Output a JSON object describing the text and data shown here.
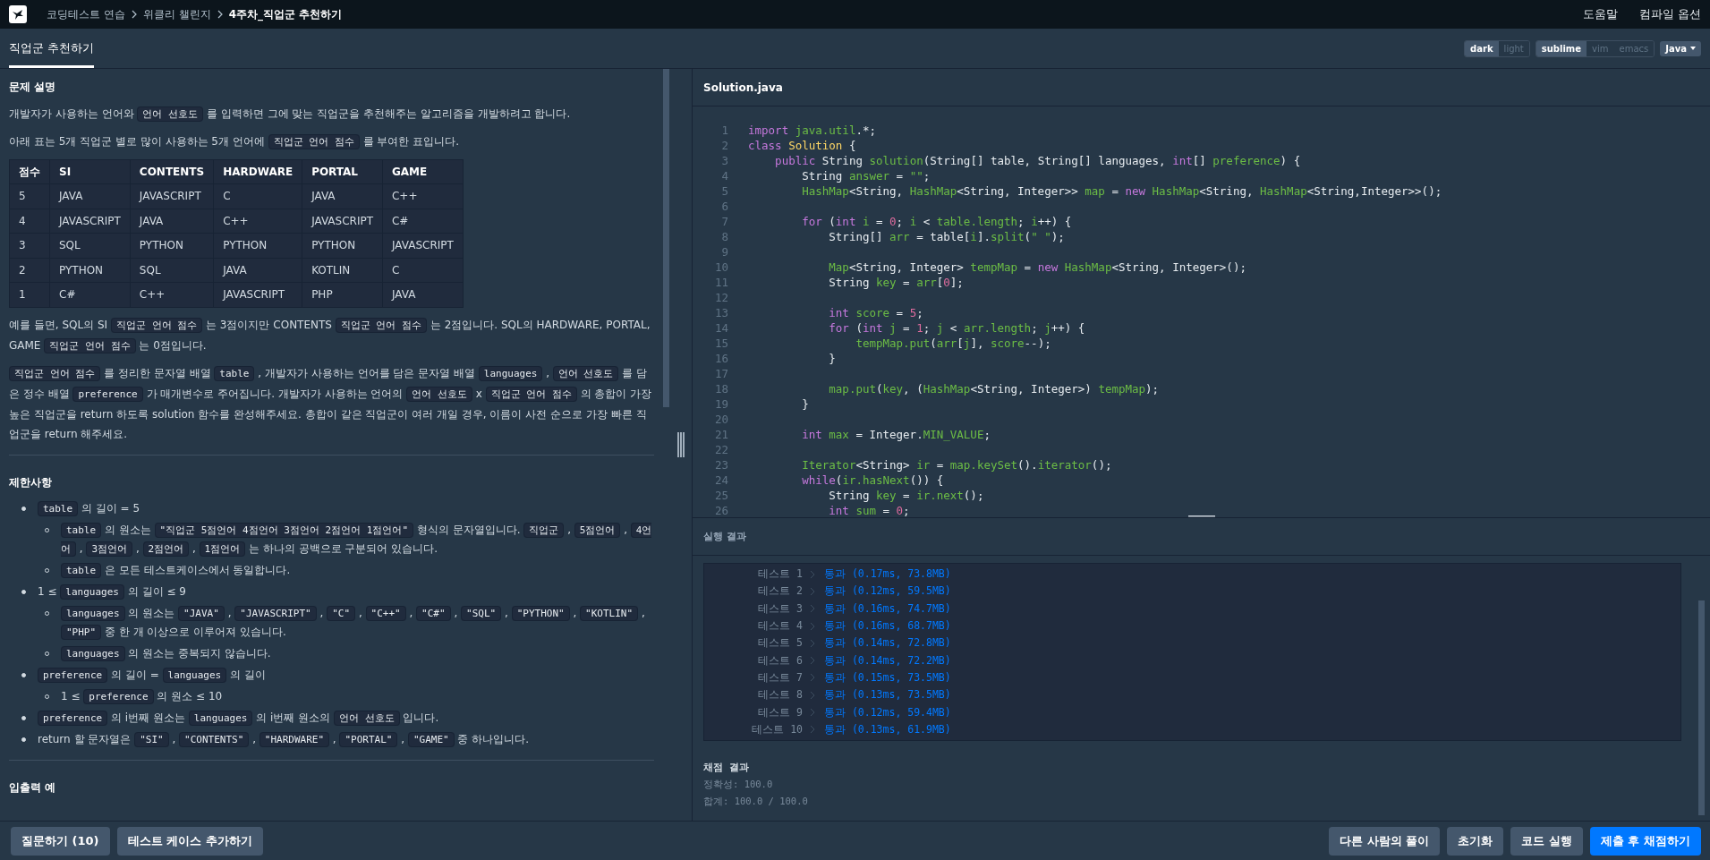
{
  "nav": {
    "breadcrumbs": [
      {
        "text": "코딩테스트 연습",
        "current": false
      },
      {
        "text": "위클리 챌린지",
        "current": false
      },
      {
        "text": "4주차_직업군 추천하기",
        "current": true
      }
    ],
    "links": [
      "도움말",
      "컴파일 옵션"
    ]
  },
  "tab": {
    "label": "직업군 추천하기",
    "selected": true
  },
  "editor_options": [
    [
      {
        "label": "dark",
        "selected": true
      },
      {
        "label": "light",
        "selected": false
      }
    ],
    [
      {
        "label": "sublime",
        "selected": true
      },
      {
        "label": "vim",
        "selected": false
      },
      {
        "label": "emacs",
        "selected": false
      }
    ]
  ],
  "language_select": {
    "value": "Java"
  },
  "problem": {
    "sections": [
      {
        "title": "문제 설명",
        "blocks": [
          {
            "kind": "paragraph",
            "segments": [
              {
                "kind": "text",
                "text": "개발자가 사용하는 언어와 "
              },
              {
                "kind": "code",
                "text": "언어 선호도"
              },
              {
                "kind": "text",
                "text": " 를 입력하면 그에 맞는 직업군을 추천해주는 알고리즘을 개발하려고 합니다."
              }
            ]
          },
          {
            "kind": "paragraph",
            "segments": [
              {
                "kind": "text",
                "text": "아래 표는 5개 직업군 별로 많이 사용하는 5개 언어에 "
              },
              {
                "kind": "code",
                "text": "직업군 언어 점수"
              },
              {
                "kind": "text",
                "text": " 를 부여한 표입니다."
              }
            ]
          },
          {
            "kind": "table",
            "columns": [
              "점수",
              "SI",
              "CONTENTS",
              "HARDWARE",
              "PORTAL",
              "GAME"
            ],
            "rows": [
              [
                "5",
                "JAVA",
                "JAVASCRIPT",
                "C",
                "JAVA",
                "C++"
              ],
              [
                "4",
                "JAVASCRIPT",
                "JAVA",
                "C++",
                "JAVASCRIPT",
                "C#"
              ],
              [
                "3",
                "SQL",
                "PYTHON",
                "PYTHON",
                "PYTHON",
                "JAVASCRIPT"
              ],
              [
                "2",
                "PYTHON",
                "SQL",
                "JAVA",
                "KOTLIN",
                "C"
              ],
              [
                "1",
                "C#",
                "C++",
                "JAVASCRIPT",
                "PHP",
                "JAVA"
              ]
            ]
          },
          {
            "kind": "paragraph",
            "segments": [
              {
                "kind": "text",
                "text": "예를 들면, SQL의 SI "
              },
              {
                "kind": "code",
                "text": "직업군 언어 점수"
              },
              {
                "kind": "text",
                "text": " 는 3점이지만 CONTENTS "
              },
              {
                "kind": "code",
                "text": "직업군 언어 점수"
              },
              {
                "kind": "text",
                "text": " 는 2점입니다. SQL의 HARDWARE, PORTAL, GAME "
              },
              {
                "kind": "code",
                "text": "직업군 언어 점수"
              },
              {
                "kind": "text",
                "text": " 는 0점입니다."
              }
            ]
          },
          {
            "kind": "paragraph",
            "segments": [
              {
                "kind": "code",
                "text": "직업군 언어 점수"
              },
              {
                "kind": "text",
                "text": " 를 정리한 문자열 배열 "
              },
              {
                "kind": "code",
                "text": "table"
              },
              {
                "kind": "text",
                "text": " , 개발자가 사용하는 언어를 담은 문자열 배열 "
              },
              {
                "kind": "code",
                "text": "languages"
              },
              {
                "kind": "text",
                "text": " , "
              },
              {
                "kind": "code",
                "text": "언어 선호도"
              },
              {
                "kind": "text",
                "text": " 를 담은 정수 배열 "
              },
              {
                "kind": "code",
                "text": "preference"
              },
              {
                "kind": "text",
                "text": " 가 매개변수로 주어집니다. 개발자가 사용하는 언어의 "
              },
              {
                "kind": "code",
                "text": "언어 선호도"
              },
              {
                "kind": "text",
                "text": " x "
              },
              {
                "kind": "code",
                "text": "직업군 언어 점수"
              },
              {
                "kind": "text",
                "text": " 의 총합이 가장 높은 직업군을 return 하도록 solution 함수를 완성해주세요. 총합이 같은 직업군이 여러 개일 경우, 이름이 사전 순으로 가장 빠른 직업군을 return 해주세요."
              }
            ]
          }
        ]
      },
      {
        "title": "제한사항",
        "blocks": [
          {
            "kind": "list",
            "items": [
              {
                "segments": [
                  {
                    "kind": "code",
                    "text": "table"
                  },
                  {
                    "kind": "text",
                    "text": " 의 길이 = 5"
                  }
                ],
                "children": [
                  {
                    "segments": [
                      {
                        "kind": "code",
                        "text": "table"
                      },
                      {
                        "kind": "text",
                        "text": " 의 원소는 "
                      },
                      {
                        "kind": "code",
                        "text": "\"직업군 5점언어 4점언어 3점언어 2점언어 1점언어\""
                      },
                      {
                        "kind": "text",
                        "text": " 형식의 문자열입니다. "
                      },
                      {
                        "kind": "code",
                        "text": "직업군"
                      },
                      {
                        "kind": "text",
                        "text": " , "
                      },
                      {
                        "kind": "code",
                        "text": "5점언어"
                      },
                      {
                        "kind": "text",
                        "text": " , "
                      },
                      {
                        "kind": "code",
                        "text": "4언어"
                      },
                      {
                        "kind": "text",
                        "text": " , "
                      },
                      {
                        "kind": "code",
                        "text": "3점언어"
                      },
                      {
                        "kind": "text",
                        "text": " , "
                      },
                      {
                        "kind": "code",
                        "text": "2점언어"
                      },
                      {
                        "kind": "text",
                        "text": " , "
                      },
                      {
                        "kind": "code",
                        "text": "1점언어"
                      },
                      {
                        "kind": "text",
                        "text": " 는 하나의 공백으로 구분되어 있습니다."
                      }
                    ]
                  },
                  {
                    "segments": [
                      {
                        "kind": "code",
                        "text": "table"
                      },
                      {
                        "kind": "text",
                        "text": " 은 모든 테스트케이스에서 동일합니다."
                      }
                    ]
                  }
                ]
              },
              {
                "segments": [
                  {
                    "kind": "text",
                    "text": "1 ≤ "
                  },
                  {
                    "kind": "code",
                    "text": "languages"
                  },
                  {
                    "kind": "text",
                    "text": " 의 길이 ≤ 9"
                  }
                ],
                "children": [
                  {
                    "segments": [
                      {
                        "kind": "code",
                        "text": "languages"
                      },
                      {
                        "kind": "text",
                        "text": " 의 원소는 "
                      },
                      {
                        "kind": "code",
                        "text": "\"JAVA\""
                      },
                      {
                        "kind": "text",
                        "text": " , "
                      },
                      {
                        "kind": "code",
                        "text": "\"JAVASCRIPT\""
                      },
                      {
                        "kind": "text",
                        "text": " , "
                      },
                      {
                        "kind": "code",
                        "text": "\"C\""
                      },
                      {
                        "kind": "text",
                        "text": " , "
                      },
                      {
                        "kind": "code",
                        "text": "\"C++\""
                      },
                      {
                        "kind": "text",
                        "text": " , "
                      },
                      {
                        "kind": "code",
                        "text": "\"C#\""
                      },
                      {
                        "kind": "text",
                        "text": " , "
                      },
                      {
                        "kind": "code",
                        "text": "\"SQL\""
                      },
                      {
                        "kind": "text",
                        "text": " , "
                      },
                      {
                        "kind": "code",
                        "text": "\"PYTHON\""
                      },
                      {
                        "kind": "text",
                        "text": " , "
                      },
                      {
                        "kind": "code",
                        "text": "\"KOTLIN\""
                      },
                      {
                        "kind": "text",
                        "text": " , "
                      },
                      {
                        "kind": "code",
                        "text": "\"PHP\""
                      },
                      {
                        "kind": "text",
                        "text": " 중 한 개 이상으로 이루어져 있습니다."
                      }
                    ]
                  },
                  {
                    "segments": [
                      {
                        "kind": "code",
                        "text": "languages"
                      },
                      {
                        "kind": "text",
                        "text": " 의 원소는 중복되지 않습니다."
                      }
                    ]
                  }
                ]
              },
              {
                "segments": [
                  {
                    "kind": "code",
                    "text": "preference"
                  },
                  {
                    "kind": "text",
                    "text": " 의 길이 = "
                  },
                  {
                    "kind": "code",
                    "text": "languages"
                  },
                  {
                    "kind": "text",
                    "text": " 의 길이"
                  }
                ],
                "children": [
                  {
                    "segments": [
                      {
                        "kind": "text",
                        "text": "1 ≤ "
                      },
                      {
                        "kind": "code",
                        "text": "preference"
                      },
                      {
                        "kind": "text",
                        "text": " 의 원소 ≤ 10"
                      }
                    ]
                  }
                ]
              },
              {
                "segments": [
                  {
                    "kind": "code",
                    "text": "preference"
                  },
                  {
                    "kind": "text",
                    "text": " 의 i번째 원소는 "
                  },
                  {
                    "kind": "code",
                    "text": "languages"
                  },
                  {
                    "kind": "text",
                    "text": " 의 i번째 원소의 "
                  },
                  {
                    "kind": "code",
                    "text": "언어 선호도"
                  },
                  {
                    "kind": "text",
                    "text": " 입니다."
                  }
                ]
              },
              {
                "segments": [
                  {
                    "kind": "text",
                    "text": "return 할 문자열은 "
                  },
                  {
                    "kind": "code",
                    "text": "\"SI\""
                  },
                  {
                    "kind": "text",
                    "text": " , "
                  },
                  {
                    "kind": "code",
                    "text": "\"CONTENTS\""
                  },
                  {
                    "kind": "text",
                    "text": " , "
                  },
                  {
                    "kind": "code",
                    "text": "\"HARDWARE\""
                  },
                  {
                    "kind": "text",
                    "text": " , "
                  },
                  {
                    "kind": "code",
                    "text": "\"PORTAL\""
                  },
                  {
                    "kind": "text",
                    "text": " , "
                  },
                  {
                    "kind": "code",
                    "text": "\"GAME\""
                  },
                  {
                    "kind": "text",
                    "text": " 중 하나입니다."
                  }
                ]
              }
            ]
          }
        ]
      },
      {
        "title": "입출력 예"
      }
    ]
  },
  "editor": {
    "filename": "Solution.java",
    "lines": [
      {
        "number": "1",
        "tokens": [
          {
            "kind": "k",
            "text": "import "
          },
          {
            "kind": "v",
            "text": "java.util"
          },
          {
            "kind": "p",
            "text": ".*;"
          }
        ]
      },
      {
        "number": "2",
        "tokens": [
          {
            "kind": "k",
            "text": "class "
          },
          {
            "kind": "c",
            "text": "Solution"
          },
          {
            "kind": "p",
            "text": " {"
          }
        ]
      },
      {
        "number": "3",
        "tokens": [
          {
            "kind": "k",
            "text": "    public "
          },
          {
            "kind": "p",
            "text": "String "
          },
          {
            "kind": "v",
            "text": "solution"
          },
          {
            "kind": "p",
            "text": "(String[] table, String[] languages, "
          },
          {
            "kind": "k",
            "text": "int"
          },
          {
            "kind": "p",
            "text": "[] "
          },
          {
            "kind": "v",
            "text": "preference"
          },
          {
            "kind": "p",
            "text": ") {"
          }
        ]
      },
      {
        "number": "4",
        "tokens": [
          {
            "kind": "p",
            "text": "        String "
          },
          {
            "kind": "v",
            "text": "answer"
          },
          {
            "kind": "p",
            "text": " = "
          },
          {
            "kind": "s",
            "text": "\"\""
          },
          {
            "kind": "p",
            "text": ";"
          }
        ]
      },
      {
        "number": "5",
        "tokens": [
          {
            "kind": "v",
            "text": "        HashMap"
          },
          {
            "kind": "p",
            "text": "<String, "
          },
          {
            "kind": "v",
            "text": "HashMap"
          },
          {
            "kind": "p",
            "text": "<String, Integer>> "
          },
          {
            "kind": "v",
            "text": "map"
          },
          {
            "kind": "p",
            "text": " = "
          },
          {
            "kind": "k",
            "text": "new "
          },
          {
            "kind": "v",
            "text": "HashMap"
          },
          {
            "kind": "p",
            "text": "<String, "
          },
          {
            "kind": "v",
            "text": "HashMap"
          },
          {
            "kind": "p",
            "text": "<String,Integer>>();"
          }
        ]
      },
      {
        "number": "6"
      },
      {
        "number": "7",
        "tokens": [
          {
            "kind": "k",
            "text": "        for "
          },
          {
            "kind": "p",
            "text": "("
          },
          {
            "kind": "k",
            "text": "int "
          },
          {
            "kind": "v",
            "text": "i"
          },
          {
            "kind": "p",
            "text": " = "
          },
          {
            "kind": "n",
            "text": "0"
          },
          {
            "kind": "p",
            "text": "; "
          },
          {
            "kind": "v",
            "text": "i"
          },
          {
            "kind": "p",
            "text": " < "
          },
          {
            "kind": "v",
            "text": "table.length"
          },
          {
            "kind": "p",
            "text": "; "
          },
          {
            "kind": "v",
            "text": "i"
          },
          {
            "kind": "p",
            "text": "++) {"
          }
        ]
      },
      {
        "number": "8",
        "tokens": [
          {
            "kind": "p",
            "text": "            String[] "
          },
          {
            "kind": "v",
            "text": "arr"
          },
          {
            "kind": "p",
            "text": " = table["
          },
          {
            "kind": "v",
            "text": "i"
          },
          {
            "kind": "p",
            "text": "]."
          },
          {
            "kind": "v",
            "text": "split"
          },
          {
            "kind": "p",
            "text": "("
          },
          {
            "kind": "s",
            "text": "\" \""
          },
          {
            "kind": "p",
            "text": ");"
          }
        ]
      },
      {
        "number": "9"
      },
      {
        "number": "10",
        "tokens": [
          {
            "kind": "v",
            "text": "            Map"
          },
          {
            "kind": "p",
            "text": "<String, Integer> "
          },
          {
            "kind": "v",
            "text": "tempMap"
          },
          {
            "kind": "p",
            "text": " = "
          },
          {
            "kind": "k",
            "text": "new "
          },
          {
            "kind": "v",
            "text": "HashMap"
          },
          {
            "kind": "p",
            "text": "<String, Integer>();"
          }
        ]
      },
      {
        "number": "11",
        "tokens": [
          {
            "kind": "p",
            "text": "            String "
          },
          {
            "kind": "v",
            "text": "key"
          },
          {
            "kind": "p",
            "text": " = "
          },
          {
            "kind": "v",
            "text": "arr"
          },
          {
            "kind": "p",
            "text": "["
          },
          {
            "kind": "n",
            "text": "0"
          },
          {
            "kind": "p",
            "text": "];"
          }
        ]
      },
      {
        "number": "12"
      },
      {
        "number": "13",
        "tokens": [
          {
            "kind": "k",
            "text": "            int "
          },
          {
            "kind": "v",
            "text": "score"
          },
          {
            "kind": "p",
            "text": " = "
          },
          {
            "kind": "n",
            "text": "5"
          },
          {
            "kind": "p",
            "text": ";"
          }
        ]
      },
      {
        "number": "14",
        "tokens": [
          {
            "kind": "k",
            "text": "            for "
          },
          {
            "kind": "p",
            "text": "("
          },
          {
            "kind": "k",
            "text": "int "
          },
          {
            "kind": "v",
            "text": "j"
          },
          {
            "kind": "p",
            "text": " = "
          },
          {
            "kind": "n",
            "text": "1"
          },
          {
            "kind": "p",
            "text": "; "
          },
          {
            "kind": "v",
            "text": "j"
          },
          {
            "kind": "p",
            "text": " < "
          },
          {
            "kind": "v",
            "text": "arr.length"
          },
          {
            "kind": "p",
            "text": "; "
          },
          {
            "kind": "v",
            "text": "j"
          },
          {
            "kind": "p",
            "text": "++) {"
          }
        ]
      },
      {
        "number": "15",
        "tokens": [
          {
            "kind": "v",
            "text": "                tempMap.put"
          },
          {
            "kind": "p",
            "text": "("
          },
          {
            "kind": "v",
            "text": "arr"
          },
          {
            "kind": "p",
            "text": "["
          },
          {
            "kind": "v",
            "text": "j"
          },
          {
            "kind": "p",
            "text": "], "
          },
          {
            "kind": "v",
            "text": "score"
          },
          {
            "kind": "p",
            "text": "--);"
          }
        ]
      },
      {
        "number": "16",
        "tokens": [
          {
            "kind": "p",
            "text": "            }"
          }
        ]
      },
      {
        "number": "17"
      },
      {
        "number": "18",
        "tokens": [
          {
            "kind": "v",
            "text": "            map.put"
          },
          {
            "kind": "p",
            "text": "("
          },
          {
            "kind": "v",
            "text": "key"
          },
          {
            "kind": "p",
            "text": ", ("
          },
          {
            "kind": "v",
            "text": "HashMap"
          },
          {
            "kind": "p",
            "text": "<String, Integer>) "
          },
          {
            "kind": "v",
            "text": "tempMap"
          },
          {
            "kind": "p",
            "text": ");"
          }
        ]
      },
      {
        "number": "19",
        "tokens": [
          {
            "kind": "p",
            "text": "        }"
          }
        ]
      },
      {
        "number": "20"
      },
      {
        "number": "21",
        "tokens": [
          {
            "kind": "k",
            "text": "        int "
          },
          {
            "kind": "v",
            "text": "max"
          },
          {
            "kind": "p",
            "text": " = Integer."
          },
          {
            "kind": "v",
            "text": "MIN_VALUE"
          },
          {
            "kind": "p",
            "text": ";"
          }
        ]
      },
      {
        "number": "22"
      },
      {
        "number": "23",
        "tokens": [
          {
            "kind": "v",
            "text": "        Iterator"
          },
          {
            "kind": "p",
            "text": "<String> "
          },
          {
            "kind": "v",
            "text": "ir"
          },
          {
            "kind": "p",
            "text": " = "
          },
          {
            "kind": "v",
            "text": "map.keySet"
          },
          {
            "kind": "p",
            "text": "()."
          },
          {
            "kind": "v",
            "text": "iterator"
          },
          {
            "kind": "p",
            "text": "();"
          }
        ]
      },
      {
        "number": "24",
        "tokens": [
          {
            "kind": "k",
            "text": "        while"
          },
          {
            "kind": "p",
            "text": "("
          },
          {
            "kind": "v",
            "text": "ir.hasNext"
          },
          {
            "kind": "p",
            "text": "()) {"
          }
        ]
      },
      {
        "number": "25",
        "tokens": [
          {
            "kind": "p",
            "text": "            String "
          },
          {
            "kind": "v",
            "text": "key"
          },
          {
            "kind": "p",
            "text": " = "
          },
          {
            "kind": "v",
            "text": "ir.next"
          },
          {
            "kind": "p",
            "text": "();"
          }
        ]
      },
      {
        "number": "26",
        "tokens": [
          {
            "kind": "k",
            "text": "            int "
          },
          {
            "kind": "v",
            "text": "sum"
          },
          {
            "kind": "p",
            "text": " = "
          },
          {
            "kind": "n",
            "text": "0"
          },
          {
            "kind": "p",
            "text": ";"
          }
        ]
      }
    ]
  },
  "results": {
    "title": "실행 결과",
    "tests": [
      {
        "label": "테스트 1",
        "result": "통과 (0.17ms, 73.8MB)"
      },
      {
        "label": "테스트 2",
        "result": "통과 (0.12ms, 59.5MB)"
      },
      {
        "label": "테스트 3",
        "result": "통과 (0.16ms, 74.7MB)"
      },
      {
        "label": "테스트 4",
        "result": "통과 (0.16ms, 68.7MB)"
      },
      {
        "label": "테스트 5",
        "result": "통과 (0.14ms, 72.8MB)"
      },
      {
        "label": "테스트 6",
        "result": "통과 (0.14ms, 72.2MB)"
      },
      {
        "label": "테스트 7",
        "result": "통과 (0.15ms, 73.5MB)"
      },
      {
        "label": "테스트 8",
        "result": "통과 (0.13ms, 73.5MB)"
      },
      {
        "label": "테스트 9",
        "result": "통과 (0.12ms, 59.4MB)"
      },
      {
        "label": "테스트 10",
        "result": "통과 (0.13ms, 61.9MB)"
      }
    ],
    "summary_title": "채점 결과",
    "summary_lines": [
      "정확성: 100.0",
      "합계: 100.0 / 100.0"
    ]
  },
  "footer": {
    "left_buttons": [
      {
        "label": "질문하기 (10)",
        "kind": "secondary"
      },
      {
        "label": "테스트 케이스 추가하기",
        "kind": "secondary"
      }
    ],
    "right_buttons": [
      {
        "label": "다른 사람의 풀이",
        "kind": "secondary"
      },
      {
        "label": "초기화",
        "kind": "secondary"
      },
      {
        "label": "코드 실행",
        "kind": "secondary"
      },
      {
        "label": "제출 후 채점하기",
        "kind": "primary"
      }
    ]
  }
}
